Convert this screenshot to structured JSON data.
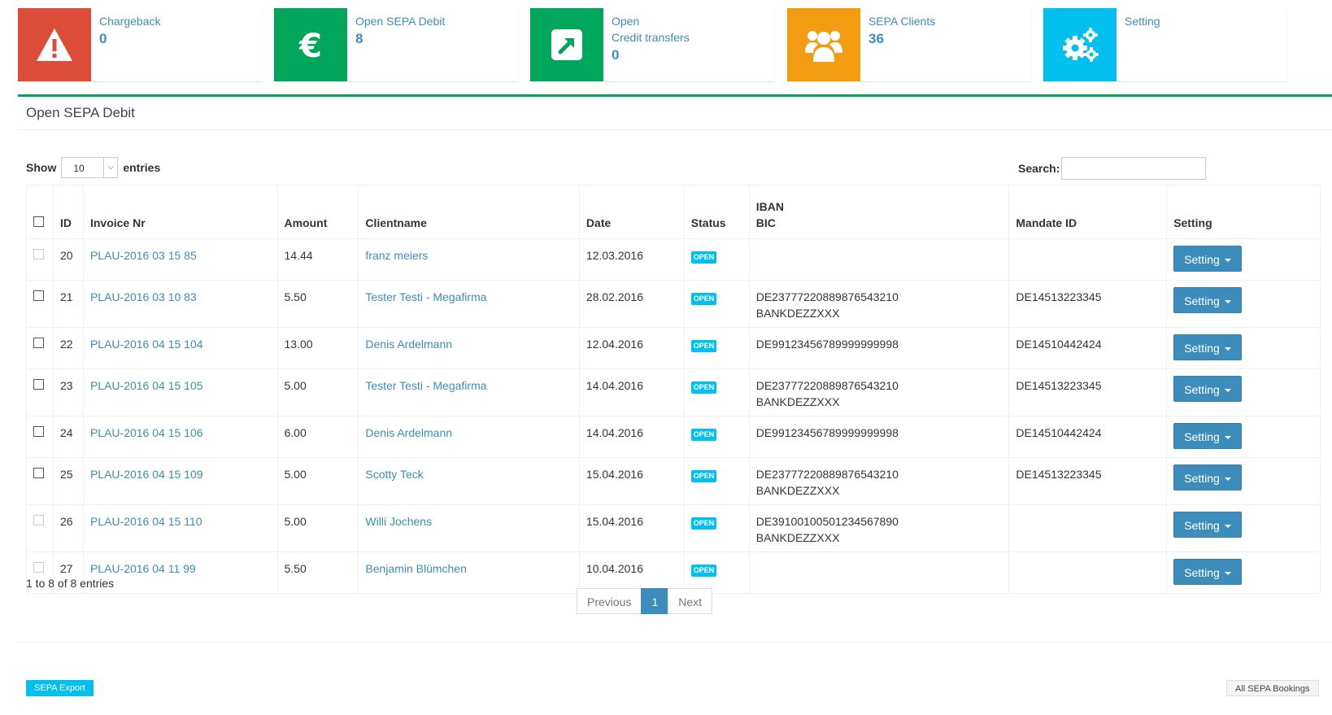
{
  "info_boxes": [
    {
      "label": "Chargeback",
      "label2": "",
      "value": "0",
      "color": "#dd4b39",
      "icon": "warning-icon"
    },
    {
      "label": "Open SEPA Debit",
      "label2": "",
      "value": "8",
      "color": "#00a65a",
      "icon": "euro-icon"
    },
    {
      "label": "Open",
      "label2": "Credit transfers",
      "value": "0",
      "color": "#00a65a",
      "icon": "external-link-icon"
    },
    {
      "label": "SEPA Clients",
      "label2": "",
      "value": "36",
      "color": "#f39c12",
      "icon": "users-icon"
    },
    {
      "label": "Setting",
      "label2": "",
      "value": "",
      "color": "#00c0ef",
      "icon": "gears-icon"
    }
  ],
  "box": {
    "title": "Open SEPA Debit",
    "accent": "#00a65a"
  },
  "table_controls": {
    "show_label": "Show",
    "entries_value": "10",
    "entries_label": "entries",
    "search_label": "Search:"
  },
  "table": {
    "headers": {
      "id": "ID",
      "invoice": "Invoice Nr",
      "amount": "Amount",
      "client": "Clientname",
      "date": "Date",
      "status": "Status",
      "iban": "IBAN",
      "bic": "BIC",
      "mandate": "Mandate ID",
      "setting": "Setting"
    },
    "rows": [
      {
        "id": "20",
        "invoice": "PLAU-2016 03 15 85",
        "amount": "14.44",
        "client": "franz meiers",
        "date": "12.03.2016",
        "status": "OPEN",
        "iban": "",
        "bic": "",
        "mandate": "",
        "setting": "Setting",
        "checkbox_enabled": false
      },
      {
        "id": "21",
        "invoice": "PLAU-2016 03 10 83",
        "amount": "5.50",
        "client": "Tester Testi - Megafirma",
        "date": "28.02.2016",
        "status": "OPEN",
        "iban": "DE23777220889876543210",
        "bic": "BANKDEZZXXX",
        "mandate": "DE14513223345",
        "setting": "Setting",
        "checkbox_enabled": true
      },
      {
        "id": "22",
        "invoice": "PLAU-2016 04 15 104",
        "amount": "13.00",
        "client": "Denis Ardelmann",
        "date": "12.04.2016",
        "status": "OPEN",
        "iban": "DE99123456789999999998",
        "bic": "",
        "mandate": "DE14510442424",
        "setting": "Setting",
        "checkbox_enabled": true
      },
      {
        "id": "23",
        "invoice": "PLAU-2016 04 15 105",
        "amount": "5.00",
        "client": "Tester Testi - Megafirma",
        "date": "14.04.2016",
        "status": "OPEN",
        "iban": "DE23777220889876543210",
        "bic": "BANKDEZZXXX",
        "mandate": "DE14513223345",
        "setting": "Setting",
        "checkbox_enabled": true
      },
      {
        "id": "24",
        "invoice": "PLAU-2016 04 15 106",
        "amount": "6.00",
        "client": "Denis Ardelmann",
        "date": "14.04.2016",
        "status": "OPEN",
        "iban": "DE99123456789999999998",
        "bic": "",
        "mandate": "DE14510442424",
        "setting": "Setting",
        "checkbox_enabled": true
      },
      {
        "id": "25",
        "invoice": "PLAU-2016 04 15 109",
        "amount": "5.00",
        "client": "Scotty Teck",
        "date": "15.04.2016",
        "status": "OPEN",
        "iban": "DE23777220889876543210",
        "bic": "BANKDEZZXXX",
        "mandate": "DE14513223345",
        "setting": "Setting",
        "checkbox_enabled": true
      },
      {
        "id": "26",
        "invoice": "PLAU-2016 04 15 110",
        "amount": "5.00",
        "client": "Willi Jochens",
        "date": "15.04.2016",
        "status": "OPEN",
        "iban": "DE39100100501234567890",
        "bic": "BANKDEZZXXX",
        "mandate": "",
        "setting": "Setting",
        "checkbox_enabled": false
      },
      {
        "id": "27",
        "invoice": "PLAU-2016 04 11 99",
        "amount": "5.50",
        "client": "Benjamin Blümchen",
        "date": "10.04.2016",
        "status": "OPEN",
        "iban": "",
        "bic": "",
        "mandate": "",
        "setting": "Setting",
        "checkbox_enabled": false
      }
    ]
  },
  "footer": {
    "entries_info": "1 to 8 of 8 entries",
    "prev": "Previous",
    "page": "1",
    "next": "Next",
    "export_label": "SEPA Export",
    "bookings_label": "All SEPA Bookings"
  }
}
